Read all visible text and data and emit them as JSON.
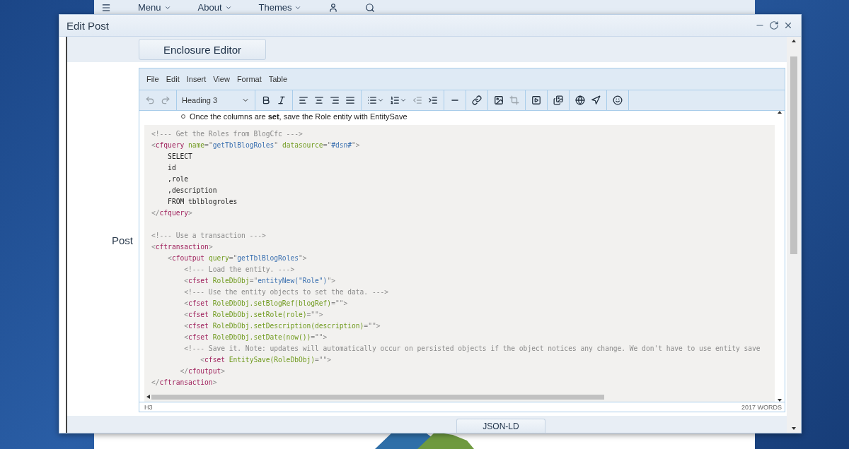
{
  "page": {
    "nav": [
      {
        "kind": "menu-icon"
      },
      {
        "kind": "dropdown",
        "label": "Menu"
      },
      {
        "kind": "dropdown",
        "label": "About"
      },
      {
        "kind": "dropdown",
        "label": "Themes"
      },
      {
        "kind": "user"
      },
      {
        "kind": "search"
      }
    ]
  },
  "dialog": {
    "title": "Edit Post",
    "enclosure_button": "Enclosure Editor",
    "field_label": "Post",
    "editor": {
      "menu": [
        "File",
        "Edit",
        "Insert",
        "View",
        "Format",
        "Table"
      ],
      "toolbar": [
        [
          {
            "kind": "undo",
            "disabled": true
          },
          {
            "kind": "redo",
            "disabled": true
          }
        ],
        [
          {
            "kind": "format-select",
            "label": "Heading 3",
            "disabled": false
          }
        ],
        [
          {
            "kind": "bold",
            "disabled": false
          },
          {
            "kind": "italic",
            "disabled": false
          }
        ],
        [
          {
            "kind": "align-left",
            "disabled": false
          },
          {
            "kind": "align-center",
            "disabled": false
          },
          {
            "kind": "align-right",
            "disabled": false
          },
          {
            "kind": "align-justify",
            "disabled": false
          }
        ],
        [
          {
            "kind": "bullet-list",
            "disabled": false
          },
          {
            "kind": "numbered-list",
            "disabled": false
          },
          {
            "kind": "outdent",
            "disabled": true
          },
          {
            "kind": "indent",
            "disabled": false
          }
        ],
        [
          {
            "kind": "rule",
            "disabled": false
          }
        ],
        [
          {
            "kind": "link",
            "disabled": false
          }
        ],
        [
          {
            "kind": "image",
            "disabled": false
          },
          {
            "kind": "crop",
            "disabled": true
          }
        ],
        [
          {
            "kind": "media",
            "disabled": false
          }
        ],
        [
          {
            "kind": "gallery",
            "disabled": false
          }
        ],
        [
          {
            "kind": "globe",
            "disabled": false
          },
          {
            "kind": "navigate",
            "disabled": false
          }
        ],
        [
          {
            "kind": "emoji",
            "disabled": false
          }
        ]
      ],
      "bullet": "Once the columns are **set**, save the Role entity with EntitySave",
      "code": [
        {
          "tokens": [
            {
              "kind": "comment",
              "text": "<!--- Get the Roles from BlogCfc --->"
            }
          ]
        },
        {
          "tokens": [
            {
              "kind": "punct",
              "text": "<"
            },
            {
              "kind": "tag",
              "text": "cfquery "
            },
            {
              "kind": "attr",
              "text": "name"
            },
            {
              "kind": "punct",
              "text": "=\""
            },
            {
              "kind": "string",
              "text": "getTblBlogRoles"
            },
            {
              "kind": "punct",
              "text": "\" "
            },
            {
              "kind": "attr",
              "text": "datasource"
            },
            {
              "kind": "punct",
              "text": "=\""
            },
            {
              "kind": "string",
              "text": "#dsn#"
            },
            {
              "kind": "punct",
              "text": "\">"
            }
          ]
        },
        {
          "tokens": [
            {
              "kind": "plain",
              "text": "    SELECT"
            }
          ]
        },
        {
          "tokens": [
            {
              "kind": "plain",
              "text": "    id"
            }
          ]
        },
        {
          "tokens": [
            {
              "kind": "plain",
              "text": "    ,role"
            }
          ]
        },
        {
          "tokens": [
            {
              "kind": "plain",
              "text": "    ,description"
            }
          ]
        },
        {
          "tokens": [
            {
              "kind": "plain",
              "text": "    FROM tblblogroles"
            }
          ]
        },
        {
          "tokens": [
            {
              "kind": "punct",
              "text": "</"
            },
            {
              "kind": "tag",
              "text": "cfquery"
            },
            {
              "kind": "punct",
              "text": ">"
            }
          ]
        },
        {
          "space_before": true,
          "tokens": [
            {
              "kind": "comment",
              "text": "<!--- Use a transaction --->"
            }
          ]
        },
        {
          "tokens": [
            {
              "kind": "punct",
              "text": "<"
            },
            {
              "kind": "tag",
              "text": "cftransaction"
            },
            {
              "kind": "punct",
              "text": ">"
            }
          ]
        },
        {
          "tokens": [
            {
              "kind": "punct",
              "text": "    <"
            },
            {
              "kind": "tag",
              "text": "cfoutput "
            },
            {
              "kind": "attr",
              "text": "query"
            },
            {
              "kind": "punct",
              "text": "=\""
            },
            {
              "kind": "string",
              "text": "getTblBlogRoles"
            },
            {
              "kind": "punct",
              "text": "\">"
            }
          ]
        },
        {
          "tokens": [
            {
              "kind": "comment",
              "text": "        <!--- Load the entity. --->"
            }
          ]
        },
        {
          "tokens": [
            {
              "kind": "punct",
              "text": "        <"
            },
            {
              "kind": "tag",
              "text": "cfset "
            },
            {
              "kind": "attr",
              "text": "RoleDbObj"
            },
            {
              "kind": "punct",
              "text": "=\""
            },
            {
              "kind": "string",
              "text": "entityNew(\"Role\")"
            },
            {
              "kind": "punct",
              "text": "\">"
            }
          ]
        },
        {
          "tokens": [
            {
              "kind": "comment",
              "text": "        <!--- Use the entity objects to set the data. --->"
            }
          ]
        },
        {
          "tokens": [
            {
              "kind": "punct",
              "text": "        <"
            },
            {
              "kind": "tag",
              "text": "cfset "
            },
            {
              "kind": "attr",
              "text": "RoleDbObj.setBlogRef(blogRef)"
            },
            {
              "kind": "punct",
              "text": "=\"\">"
            }
          ]
        },
        {
          "tokens": [
            {
              "kind": "punct",
              "text": "        <"
            },
            {
              "kind": "tag",
              "text": "cfset "
            },
            {
              "kind": "attr",
              "text": "RoleDbObj.setRole(role)"
            },
            {
              "kind": "punct",
              "text": "=\"\">"
            }
          ]
        },
        {
          "tokens": [
            {
              "kind": "punct",
              "text": "        <"
            },
            {
              "kind": "tag",
              "text": "cfset "
            },
            {
              "kind": "attr",
              "text": "RoleDbObj.setDescription(description)"
            },
            {
              "kind": "punct",
              "text": "=\"\">"
            }
          ]
        },
        {
          "tokens": [
            {
              "kind": "punct",
              "text": "        <"
            },
            {
              "kind": "tag",
              "text": "cfset "
            },
            {
              "kind": "attr",
              "text": "RoleDbObj.setDate(now())"
            },
            {
              "kind": "punct",
              "text": "=\"\">"
            }
          ]
        },
        {
          "tokens": [
            {
              "kind": "comment",
              "text": "        <!--- Save it. Note: updates will automatically occur on persisted objects if the object notices any change. We don't have to use entity save"
            }
          ]
        },
        {
          "tokens": [
            {
              "kind": "punct",
              "text": "            <"
            },
            {
              "kind": "tag",
              "text": "cfset "
            },
            {
              "kind": "attr",
              "text": "EntitySave(RoleDbObj)"
            },
            {
              "kind": "punct",
              "text": "=\"\">"
            }
          ]
        },
        {
          "tokens": [
            {
              "kind": "punct",
              "text": "       </"
            },
            {
              "kind": "tag",
              "text": "cfoutput"
            },
            {
              "kind": "punct",
              "text": ">"
            }
          ]
        },
        {
          "tokens": [
            {
              "kind": "punct",
              "text": "</"
            },
            {
              "kind": "tag",
              "text": "cftransaction"
            },
            {
              "kind": "punct",
              "text": ">"
            }
          ]
        }
      ],
      "path": "H3",
      "word_count": "2017 WORDS"
    },
    "footer_button": "JSON-LD"
  }
}
